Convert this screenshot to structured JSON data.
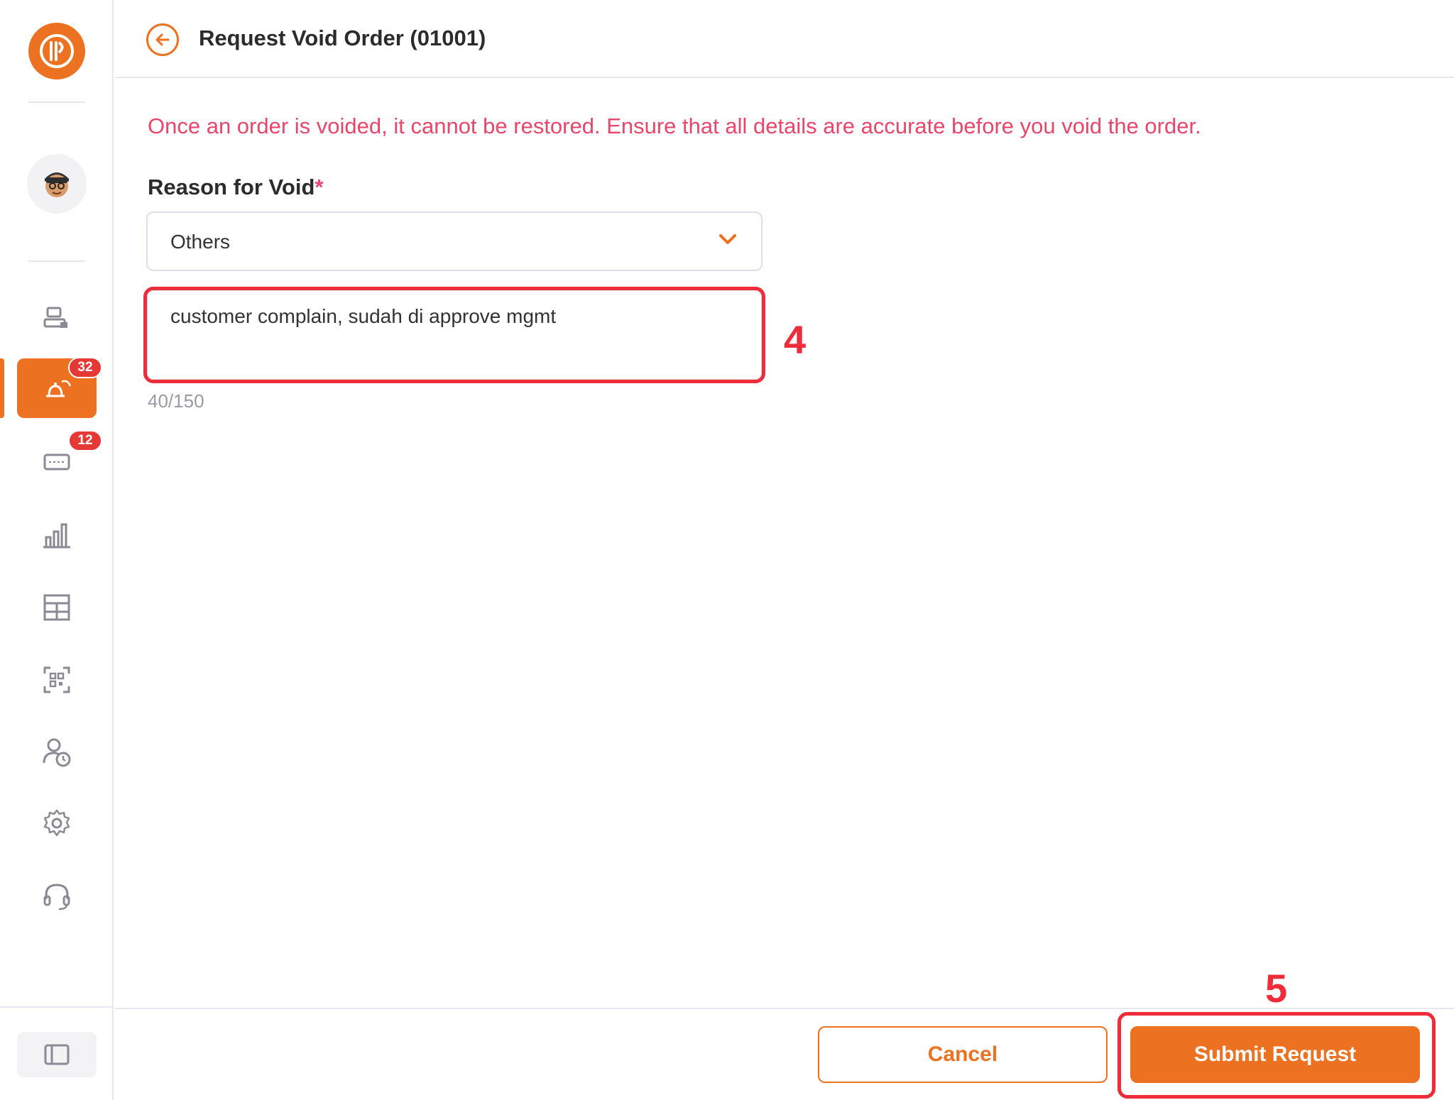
{
  "sidebar": {
    "logo_icon": "brand-logo-icon",
    "avatar_icon": "user-avatar-icon",
    "items": [
      {
        "name": "cashier-icon"
      },
      {
        "name": "orders-bell-icon",
        "badge": "32",
        "active": true
      },
      {
        "name": "ticket-icon",
        "badge": "12"
      },
      {
        "name": "reports-chart-icon"
      },
      {
        "name": "inventory-icon"
      },
      {
        "name": "qr-scan-icon"
      },
      {
        "name": "attendance-icon"
      },
      {
        "name": "settings-icon"
      },
      {
        "name": "support-headset-icon"
      }
    ],
    "collapse_icon": "sidebar-toggle-icon"
  },
  "header": {
    "back_icon": "arrow-left-icon",
    "title": "Request Void Order (01001)"
  },
  "form": {
    "warning": "Once an order is voided, it cannot be restored. Ensure that all details are accurate before you void the order.",
    "reason_label": "Reason for Void",
    "required_mark": "*",
    "reason_selected": "Others",
    "note_value": "customer complain, sudah di approve mgmt",
    "counter": "40/150"
  },
  "footer": {
    "cancel_label": "Cancel",
    "submit_label": "Submit Request"
  },
  "annotations": {
    "note_step": "4",
    "submit_step": "5"
  },
  "colors": {
    "accent": "#ec7121",
    "warning": "#e8466b",
    "badge": "#e53935",
    "annotation": "#ef2d3a"
  }
}
